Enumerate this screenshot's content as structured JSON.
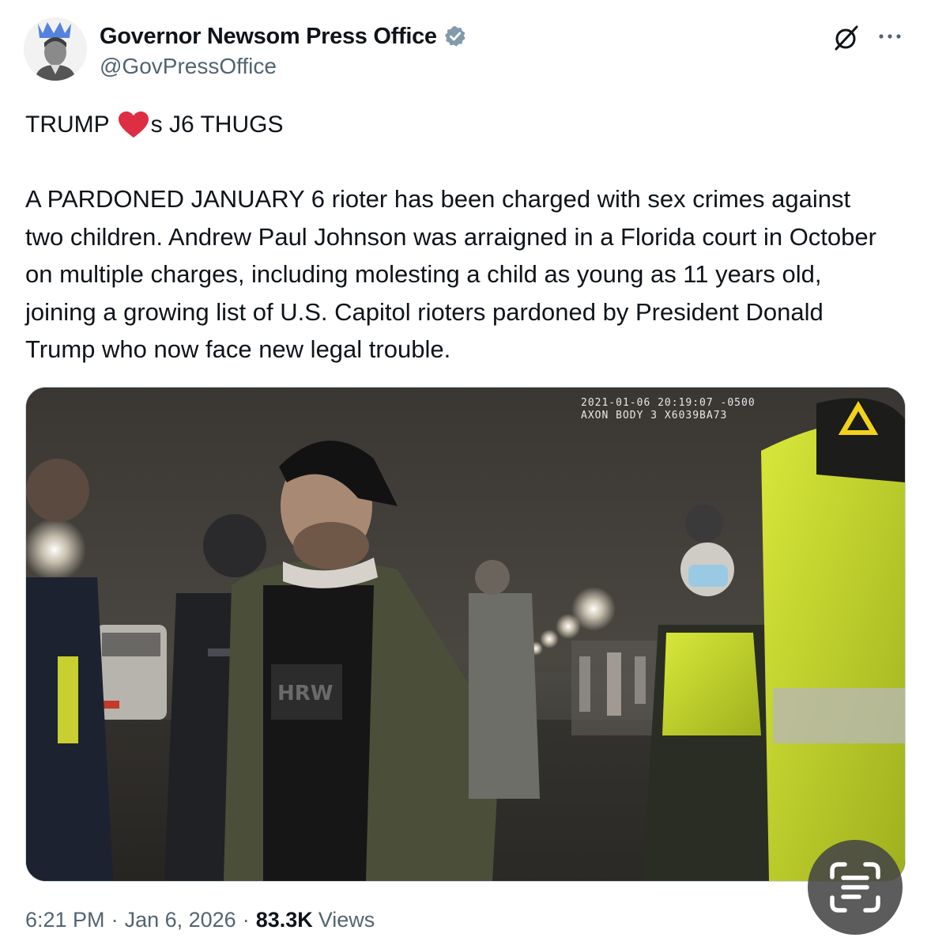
{
  "author": {
    "display_name": "Governor Newsom Press Office",
    "handle": "@GovPressOffice",
    "verified_color": "#829aab"
  },
  "post": {
    "headline_before": "TRUMP",
    "headline_after": "s J6 THUGS",
    "heart_color": "#dd2e44",
    "body": "A PARDONED JANUARY 6 rioter has been charged with sex crimes against two children. Andrew Paul Johnson was arraigned in a Florida court in October on multiple charges, including molesting a child as young as 11 years old, joining a growing list of U.S. Capitol rioters pardoned by President Donald Trump who now face new legal trouble."
  },
  "media": {
    "timestamp_line1": "2021-01-06 20:19:07 -0500",
    "timestamp_line2": "AXON BODY 3 X6039BA73"
  },
  "footer": {
    "time": "6:21 PM",
    "date": "Jan 6, 2026",
    "separator": "·",
    "views_count": "83.3K",
    "views_label": "Views"
  },
  "icons": {
    "grok": "grok-icon",
    "more": "more-icon",
    "verified": "verified-badge-icon",
    "heart": "heart-icon",
    "ocr": "text-scan-icon"
  }
}
